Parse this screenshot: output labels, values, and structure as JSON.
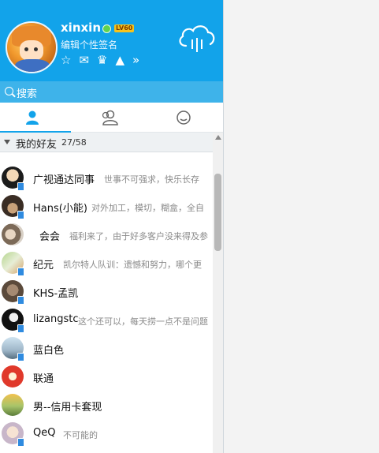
{
  "profile": {
    "nickname": "xinxin",
    "level_badge": "LV60",
    "signature": "编辑个性签名"
  },
  "header_tools": [
    "star-icon",
    "mail-icon",
    "crown-icon",
    "tent-icon",
    "more-icon"
  ],
  "search": {
    "label": "搜索"
  },
  "tabs": [
    {
      "name": "contacts",
      "icon": "person-icon",
      "active": true
    },
    {
      "name": "groups",
      "icon": "group-icon",
      "active": false
    },
    {
      "name": "messages",
      "icon": "chat-icon",
      "active": false
    }
  ],
  "group": {
    "name": "我的好友",
    "count": "27/58"
  },
  "friends": [
    {
      "name": "广视通达同事",
      "signature": "世事不可强求，快乐长存",
      "mobile": true
    },
    {
      "name": "Hans(小能)",
      "signature": "对外加工，模切，糊盒，全自",
      "mobile": true
    },
    {
      "name": "会会",
      "signature": "福利来了，由于好多客户没来得及参",
      "mobile": false
    },
    {
      "name": "纪元",
      "signature": "凯尔特人队训：遗憾和努力，哪个更",
      "mobile": true
    },
    {
      "name": "KHS-孟凯",
      "signature": "",
      "mobile": true
    },
    {
      "name": "lizangstc",
      "signature": "这个还可以，每天捞一点不是问题",
      "mobile": true
    },
    {
      "name": "蓝白色",
      "signature": "",
      "mobile": true
    },
    {
      "name": "联通",
      "signature": "",
      "mobile": false
    },
    {
      "name": "男--信用卡套现",
      "signature": "",
      "mobile": false
    },
    {
      "name": "QeQ",
      "signature": "不可能的",
      "mobile": true
    }
  ],
  "colors": {
    "accent": "#12a3ea",
    "search_bar": "#3eb3ea"
  }
}
